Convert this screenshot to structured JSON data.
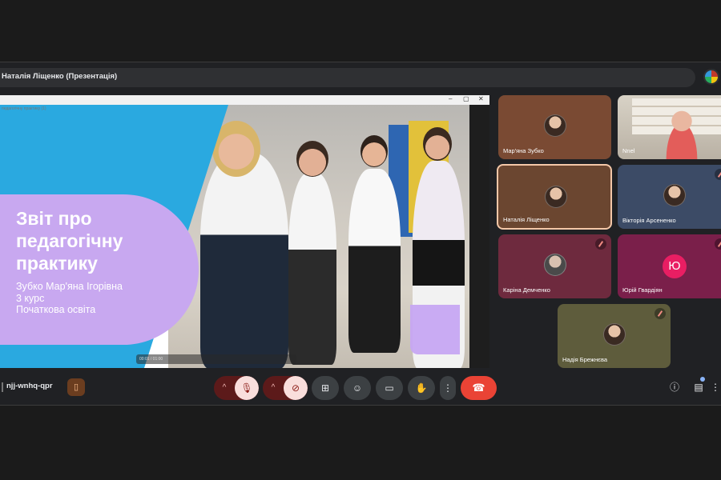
{
  "topbar": {
    "title": "Наталія Ліщенко (Презентація)"
  },
  "presentation": {
    "window_caption": "педагогічну практику (1)",
    "title": "Звіт про педагогічну практику",
    "subtitle": "Зубко Мар'яна Ігорівна\n3 курс\n Початкова освіта",
    "time": "00:01 / 01:00"
  },
  "participants": [
    {
      "name": "Мар'яна Зубко"
    },
    {
      "name": "Nnel"
    },
    {
      "name": "Наталія Ліщенко"
    },
    {
      "name": "Вікторія Арсененко"
    },
    {
      "name": "Каріна Демченко"
    },
    {
      "name": "Юрій Гвардіян",
      "initial": "Ю"
    },
    {
      "name": "Надія Брежнєва"
    }
  ],
  "bottom": {
    "meeting_code": "njj-wnhq-qpr",
    "icons": {
      "activities": "door-icon",
      "mic": "mic-off-icon",
      "camera": "camera-off-icon",
      "present": "present-icon",
      "emoji": "emoji-icon",
      "captions": "captions-icon",
      "hand": "raise-hand-icon",
      "more": "more-icon",
      "end": "end-call-icon",
      "info": "info-icon",
      "chat": "chat-icon",
      "overflow": "more-vert-icon"
    }
  },
  "colors": {
    "background": "#202124",
    "end_call": "#ea4335",
    "muted_group": "#5c1a1a",
    "slide_blue": "#2aa9e0",
    "slide_purple": "#c8a8f0",
    "active_speaker_border": "#f4c7a8"
  }
}
